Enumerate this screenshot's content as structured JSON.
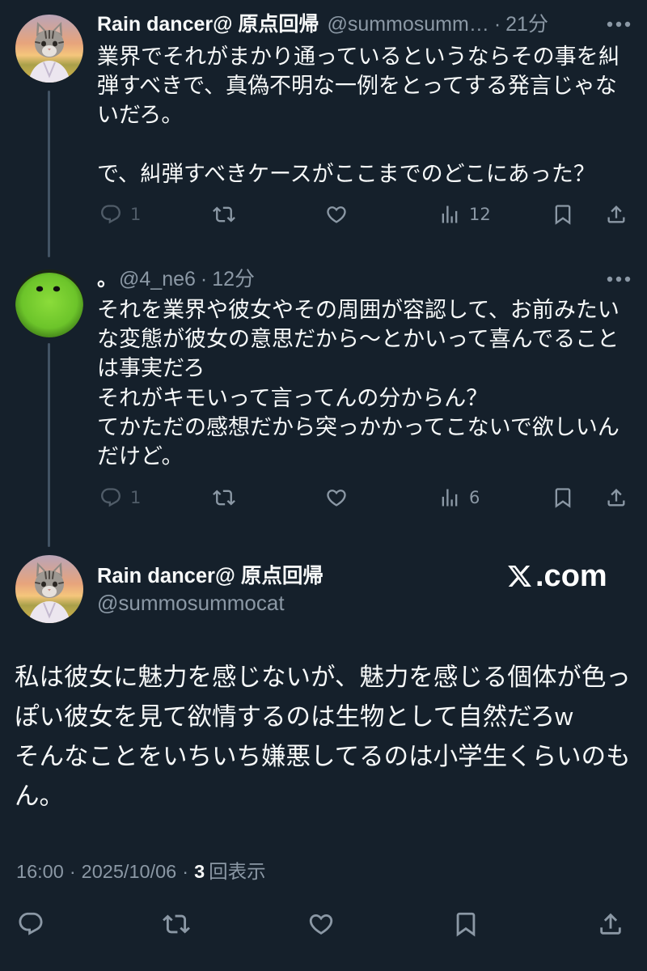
{
  "theme": {
    "background": "#15202b",
    "text": "#f7f9f9",
    "muted": "#8b98a5",
    "thread_line": "#425364"
  },
  "thread": [
    {
      "author": {
        "name": "Rain dancer@ 原点回帰",
        "handle": "@summosumm…",
        "avatar": "tabby-cat-avatar"
      },
      "separator": "·",
      "time": "21分",
      "more_icon": "more-dots-icon",
      "paragraphs": [
        [
          "業界でそれがまかり通っているというならその事を糾",
          "弾すべきで、真偽不明な一例をとってする発言じゃな",
          "いだろ。"
        ],
        [
          "で、糾弾すべきケースがここまでのどこにあった？"
        ]
      ],
      "actions": {
        "reply": {
          "icon": "reply-icon",
          "count": "1"
        },
        "retweet": {
          "icon": "retweet-icon"
        },
        "like": {
          "icon": "heart-icon"
        },
        "views": {
          "icon": "views-icon",
          "count": "12"
        },
        "bookmark": {
          "icon": "bookmark-icon"
        },
        "share": {
          "icon": "share-icon"
        }
      }
    },
    {
      "author": {
        "name": "。",
        "handle": "@4_ne6",
        "avatar": "green-blob-avatar"
      },
      "separator": "·",
      "time": "12分",
      "more_icon": "more-dots-icon",
      "paragraphs": [
        [
          "それを業界や彼女やその周囲が容認して、お前みたい",
          "な変態が彼女の意思だから〜とかいって喜んでること",
          "は事実だろ",
          "それがキモいって言ってんの分からん？",
          "てかただの感想だから突っかかってこないで欲しいん",
          "だけど。"
        ]
      ],
      "actions": {
        "reply": {
          "icon": "reply-icon",
          "count": "1"
        },
        "retweet": {
          "icon": "retweet-icon"
        },
        "like": {
          "icon": "heart-icon"
        },
        "views": {
          "icon": "views-icon",
          "count": "6"
        },
        "bookmark": {
          "icon": "bookmark-icon"
        },
        "share": {
          "icon": "share-icon"
        }
      }
    }
  ],
  "main_tweet": {
    "author": {
      "name": "Rain dancer@ 原点回帰",
      "handle": "@summosummocat",
      "avatar": "tabby-cat-avatar"
    },
    "paragraphs": [
      [
        "私は彼女に魅力を感じないが、魅力を感じる個体が色っ",
        "ぽい彼女を見て欲情するのは生物として自然だろw",
        "そんなことをいちいち嫌悪してるのは小学生くらいのも",
        "ん。"
      ]
    ],
    "meta": {
      "time": "16:00",
      "separator": "·",
      "date": "2025/10/06",
      "views_count": "3",
      "views_label": "回表示"
    },
    "actions": {
      "reply": {
        "icon": "reply-icon"
      },
      "retweet": {
        "icon": "retweet-icon"
      },
      "like": {
        "icon": "heart-icon"
      },
      "bookmark": {
        "icon": "bookmark-icon"
      },
      "share": {
        "icon": "share-icon"
      }
    }
  },
  "watermark": {
    "mark": "𝕏",
    "suffix": ".com"
  }
}
